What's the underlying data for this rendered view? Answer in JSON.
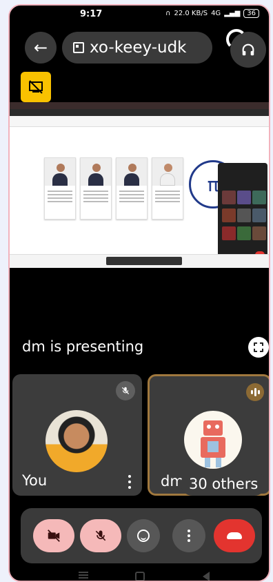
{
  "status_bar": {
    "time": "9:17",
    "network": "22.0 KB/S",
    "signal": "4G",
    "battery": "36"
  },
  "meeting": {
    "code": "xo-keey-udk"
  },
  "screen_share": {
    "presenter_text": "dm is presenting"
  },
  "participants": {
    "self_name": "You",
    "other_name": "dm",
    "others_count": "30 others"
  },
  "controls": {
    "camera": "camera-off",
    "mic": "mic-off",
    "reactions": "reactions",
    "more": "more-options",
    "hangup": "leave-call"
  },
  "colors": {
    "tile_bg": "#3c3c3c",
    "control_off": "#f5b9b9",
    "hangup": "#e3342f",
    "speaker_border": "#a0783e"
  }
}
